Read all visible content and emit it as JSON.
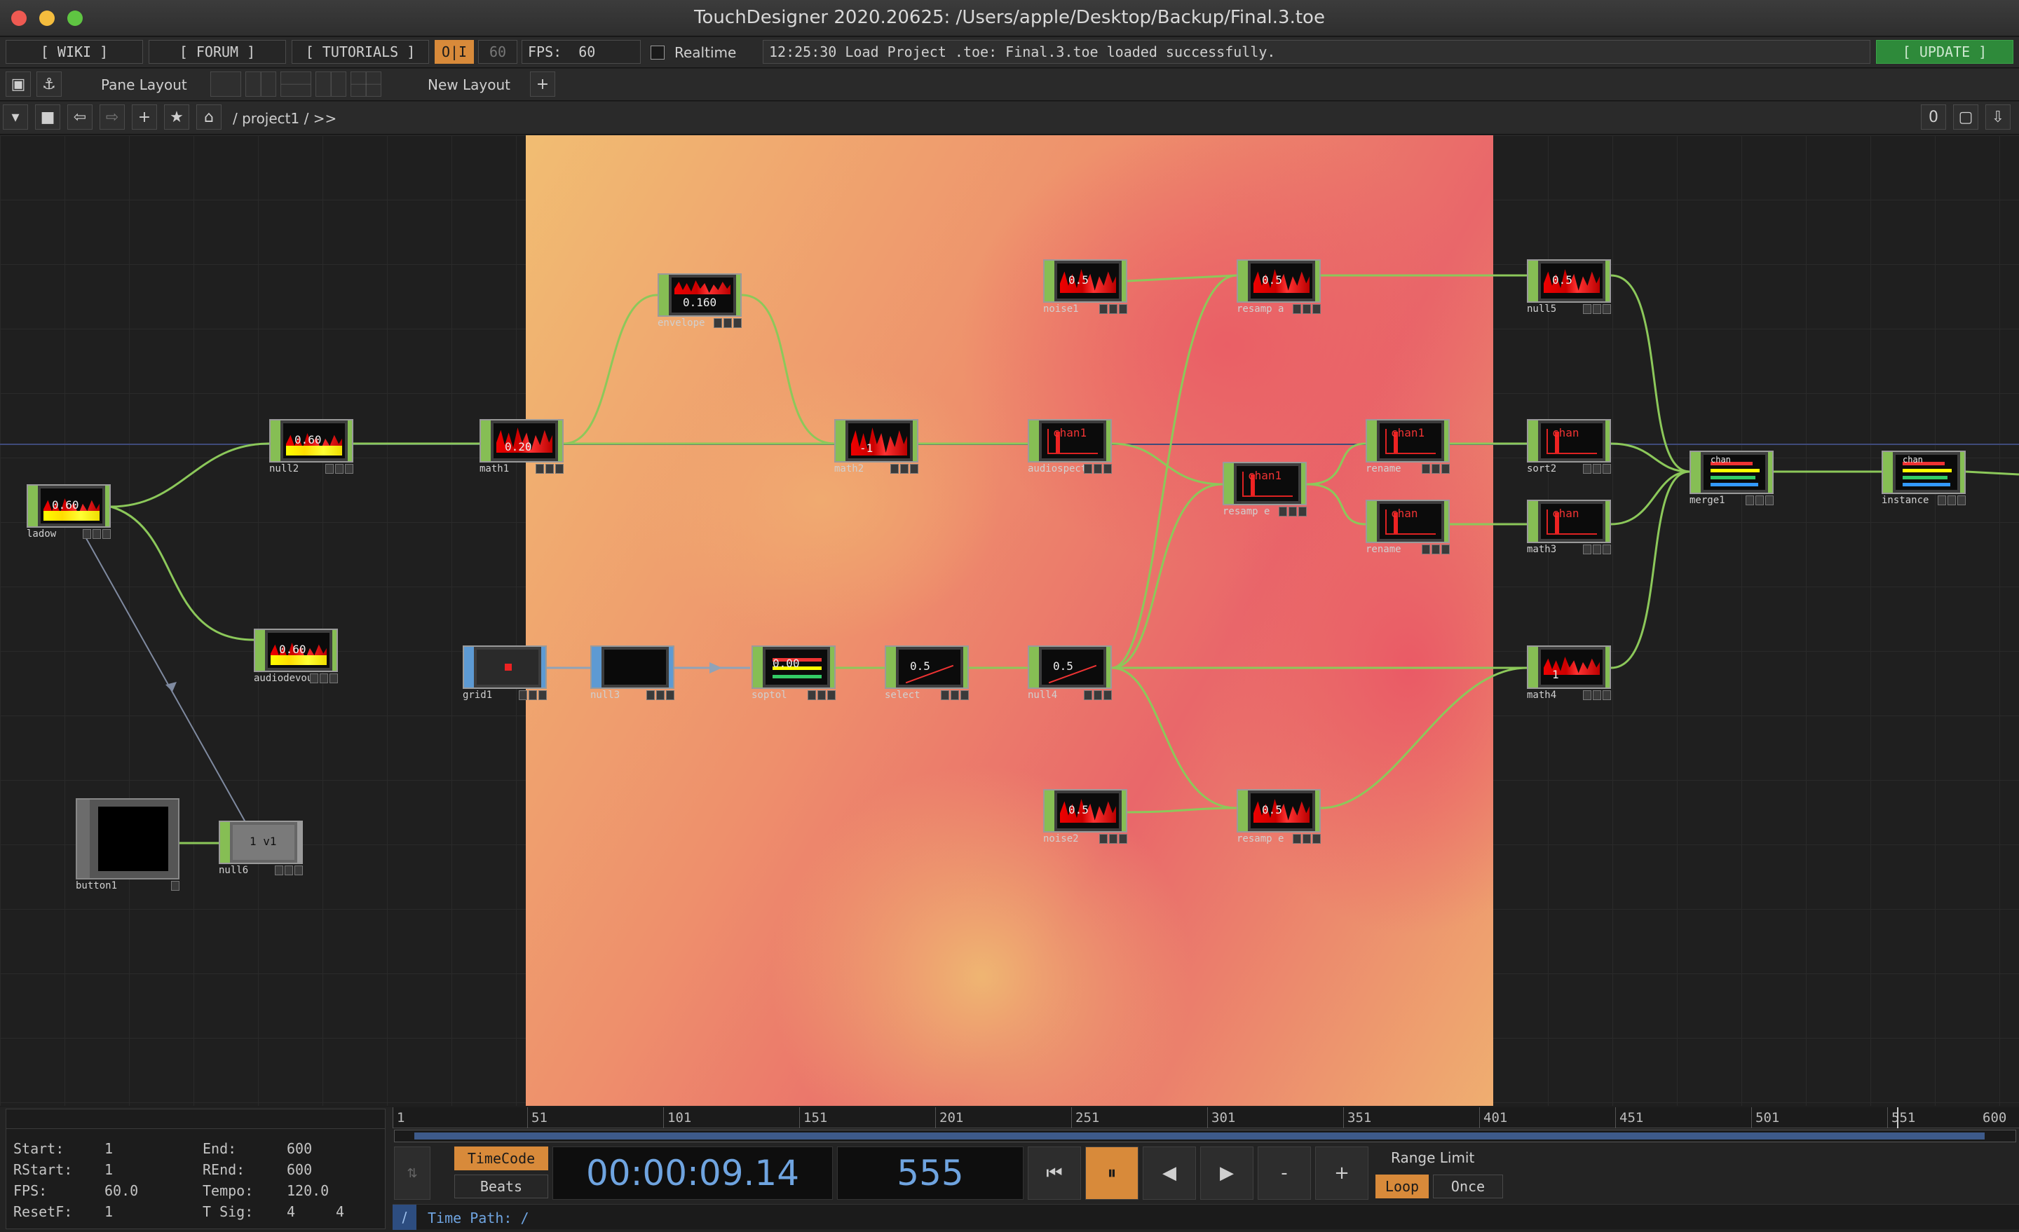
{
  "window": {
    "title": "TouchDesigner 2020.20625: /Users/apple/Desktop/Backup/Final.3.toe"
  },
  "toolbar": {
    "wiki": "[ WIKI ]",
    "forum": "[ FORUM ]",
    "tutorials": "[ TUTORIALS ]",
    "oi": "O|I",
    "fps_box": "60",
    "fps_label": "FPS:",
    "fps_value": "60",
    "realtime": "Realtime",
    "status": "12:25:30 Load Project .toe: Final.3.toe loaded successfully.",
    "update": "[ UPDATE ]"
  },
  "layoutbar": {
    "pane_layout": "Pane Layout",
    "new_layout": "New Layout",
    "plus": "+"
  },
  "pathbar": {
    "path": "/ project1 / >>",
    "zero": "0"
  },
  "nodes": [
    {
      "id": "ladow",
      "label": "ladow",
      "value": "0.60"
    },
    {
      "id": "null2",
      "label": "null2",
      "value": "0.60"
    },
    {
      "id": "math1",
      "label": "math1",
      "value": "0.20"
    },
    {
      "id": "envelope",
      "label": "envelope",
      "value": "0.160"
    },
    {
      "id": "math2",
      "label": "math2",
      "value": "-1"
    },
    {
      "id": "noise1",
      "label": "noise1",
      "value": "0.5"
    },
    {
      "id": "resamp_a",
      "label": "resamp a",
      "value": "0.5"
    },
    {
      "id": "null5",
      "label": "null5",
      "value": "0.5"
    },
    {
      "id": "audiospect",
      "label": "audiospect",
      "value": "chan1"
    },
    {
      "id": "resamp_b",
      "label": "resamp e",
      "value": "chan1"
    },
    {
      "id": "rename1",
      "label": "rename",
      "value": "chan1"
    },
    {
      "id": "rename2",
      "label": "rename",
      "value": "chan"
    },
    {
      "id": "sort2",
      "label": "sort2",
      "value": "chan"
    },
    {
      "id": "math3",
      "label": "math3",
      "value": "chan"
    },
    {
      "id": "merge1",
      "label": "merge1",
      "value": "chan"
    },
    {
      "id": "instance",
      "label": "instance",
      "value": "chan"
    },
    {
      "id": "audiodevout1",
      "label": "audiodevout1",
      "value": "0.60"
    },
    {
      "id": "grid1",
      "label": "grid1",
      "value": ""
    },
    {
      "id": "null3",
      "label": "null3",
      "value": ""
    },
    {
      "id": "soptol",
      "label": "soptol",
      "value": "0.00"
    },
    {
      "id": "select",
      "label": "select",
      "value": "0.5"
    },
    {
      "id": "null4",
      "label": "null4",
      "value": "0.5"
    },
    {
      "id": "math4",
      "label": "math4",
      "value": "1"
    },
    {
      "id": "noise2",
      "label": "noise2",
      "value": "0.5"
    },
    {
      "id": "resamp_c",
      "label": "resamp e",
      "value": "0.5"
    },
    {
      "id": "button1",
      "label": "button1",
      "value": ""
    },
    {
      "id": "null6",
      "label": "null6",
      "value": "1 v1"
    }
  ],
  "info": {
    "start_label": "Start:",
    "start": "1",
    "end_label": "End:",
    "end": "600",
    "rstart_label": "RStart:",
    "rstart": "1",
    "rend_label": "REnd:",
    "rend": "600",
    "fps_label": "FPS:",
    "fps": "60.0",
    "tempo_label": "Tempo:",
    "tempo": "120.0",
    "resetf_label": "ResetF:",
    "resetf": "1",
    "tsig_label": "T Sig:",
    "tsig1": "4",
    "tsig2": "4"
  },
  "timeline": {
    "ticks": [
      "1",
      "51",
      "101",
      "151",
      "201",
      "251",
      "301",
      "351",
      "401",
      "451",
      "501",
      "551",
      "600"
    ],
    "timecode_btn": "TimeCode",
    "beats_btn": "Beats",
    "timecode": "00:00:09.14",
    "frame": "555",
    "range_limit": "Range Limit",
    "loop": "Loop",
    "once": "Once",
    "minus": "-",
    "plus": "+",
    "time_path": "Time Path: /",
    "slash": "/"
  },
  "colors": {
    "accent": "#d88a3a",
    "chop": "#86be54",
    "top": "#5d9ad3",
    "update": "#2e8a3a"
  }
}
